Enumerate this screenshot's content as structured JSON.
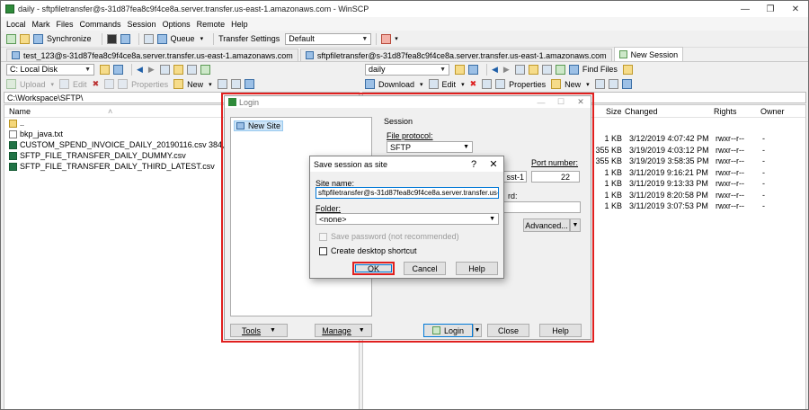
{
  "window": {
    "title": "daily - sftpfiletransfer@s-31d87fea8c9f4ce8a.server.transfer.us-east-1.amazonaws.com - WinSCP",
    "minimize": "—",
    "maximize": "❐",
    "close": "✕"
  },
  "menu": [
    "Local",
    "Mark",
    "Files",
    "Commands",
    "Session",
    "Options",
    "Remote",
    "Help"
  ],
  "toolbar": {
    "synchronize": "Synchronize",
    "queue": "Queue",
    "transfer_settings_label": "Transfer Settings",
    "transfer_settings_value": "Default"
  },
  "tabs": [
    {
      "label": "test_123@s-31d87fea8c9f4ce8a.server.transfer.us-east-1.amazonaws.com"
    },
    {
      "label": "sftpfiletransfer@s-31d87fea8c9f4ce8a.server.transfer.us-east-1.amazonaws.com"
    },
    {
      "label": "New Session"
    }
  ],
  "local": {
    "drive": "C: Local Disk",
    "upload": "Upload",
    "edit": "Edit",
    "properties": "Properties",
    "new": "New",
    "path": "C:\\Workspace\\SFTP\\",
    "col_name": "Name",
    "files": [
      {
        "name": "..",
        "size": ""
      },
      {
        "name": "bkp_java.txt",
        "size": ""
      },
      {
        "name": "CUSTOM_SPEND_INVOICE_DAILY_20190116.csv",
        "size": "384,4"
      },
      {
        "name": "SFTP_FILE_TRANSFER_DAILY_DUMMY.csv",
        "size": ""
      },
      {
        "name": "SFTP_FILE_TRANSFER_DAILY_THIRD_LATEST.csv",
        "size": ""
      }
    ]
  },
  "remote": {
    "folder": "daily",
    "find_files": "Find Files",
    "download": "Download",
    "edit": "Edit",
    "properties": "Properties",
    "new": "New",
    "col_size": "Size",
    "col_changed": "Changed",
    "col_rights": "Rights",
    "col_owner": "Owner",
    "rows": [
      {
        "size": "1 KB",
        "changed": "3/12/2019 4:07:42 PM",
        "rights": "rwxr--r--",
        "owner": "-"
      },
      {
        "size": "355 KB",
        "changed": "3/19/2019 4:03:12 PM",
        "rights": "rwxr--r--",
        "owner": "-"
      },
      {
        "size": "355 KB",
        "changed": "3/19/2019 3:58:35 PM",
        "rights": "rwxr--r--",
        "owner": "-"
      },
      {
        "size": "1 KB",
        "changed": "3/11/2019 9:16:21 PM",
        "rights": "rwxr--r--",
        "owner": "-"
      },
      {
        "size": "1 KB",
        "changed": "3/11/2019 9:13:33 PM",
        "rights": "rwxr--r--",
        "owner": "-"
      },
      {
        "size": "1 KB",
        "changed": "3/11/2019 8:20:58 PM",
        "rights": "rwxr--r--",
        "owner": "-"
      },
      {
        "size": "1 KB",
        "changed": "3/11/2019 3:07:53 PM",
        "rights": "rwxr--r--",
        "owner": "-"
      }
    ]
  },
  "login": {
    "title": "Login",
    "new_site": "New Site",
    "session_group": "Session",
    "file_protocol_label": "File protocol:",
    "file_protocol_value": "SFTP",
    "port_label": "Port number:",
    "port_value": "22",
    "host_partial": "sst-1",
    "password_partial": "rd:",
    "advanced": "Advanced...",
    "tools": "Tools",
    "manage": "Manage",
    "login": "Login",
    "close": "Close",
    "help": "Help"
  },
  "save_dialog": {
    "title": "Save session as site",
    "help_glyph": "?",
    "close_glyph": "✕",
    "site_name_label": "Site name:",
    "site_name_value": "sftpfiletransfer@s-31d87fea8c9f4ce8a.server.transfer.us-east",
    "folder_label": "Folder:",
    "folder_value": "<none>",
    "save_password_label": "Save password (not recommended)",
    "desktop_shortcut_label": "Create desktop shortcut",
    "ok": "OK",
    "cancel": "Cancel",
    "help": "Help"
  },
  "colors": {
    "highlight": "#e0201f",
    "selection": "#cce4f7",
    "accent": "#0078d7"
  }
}
